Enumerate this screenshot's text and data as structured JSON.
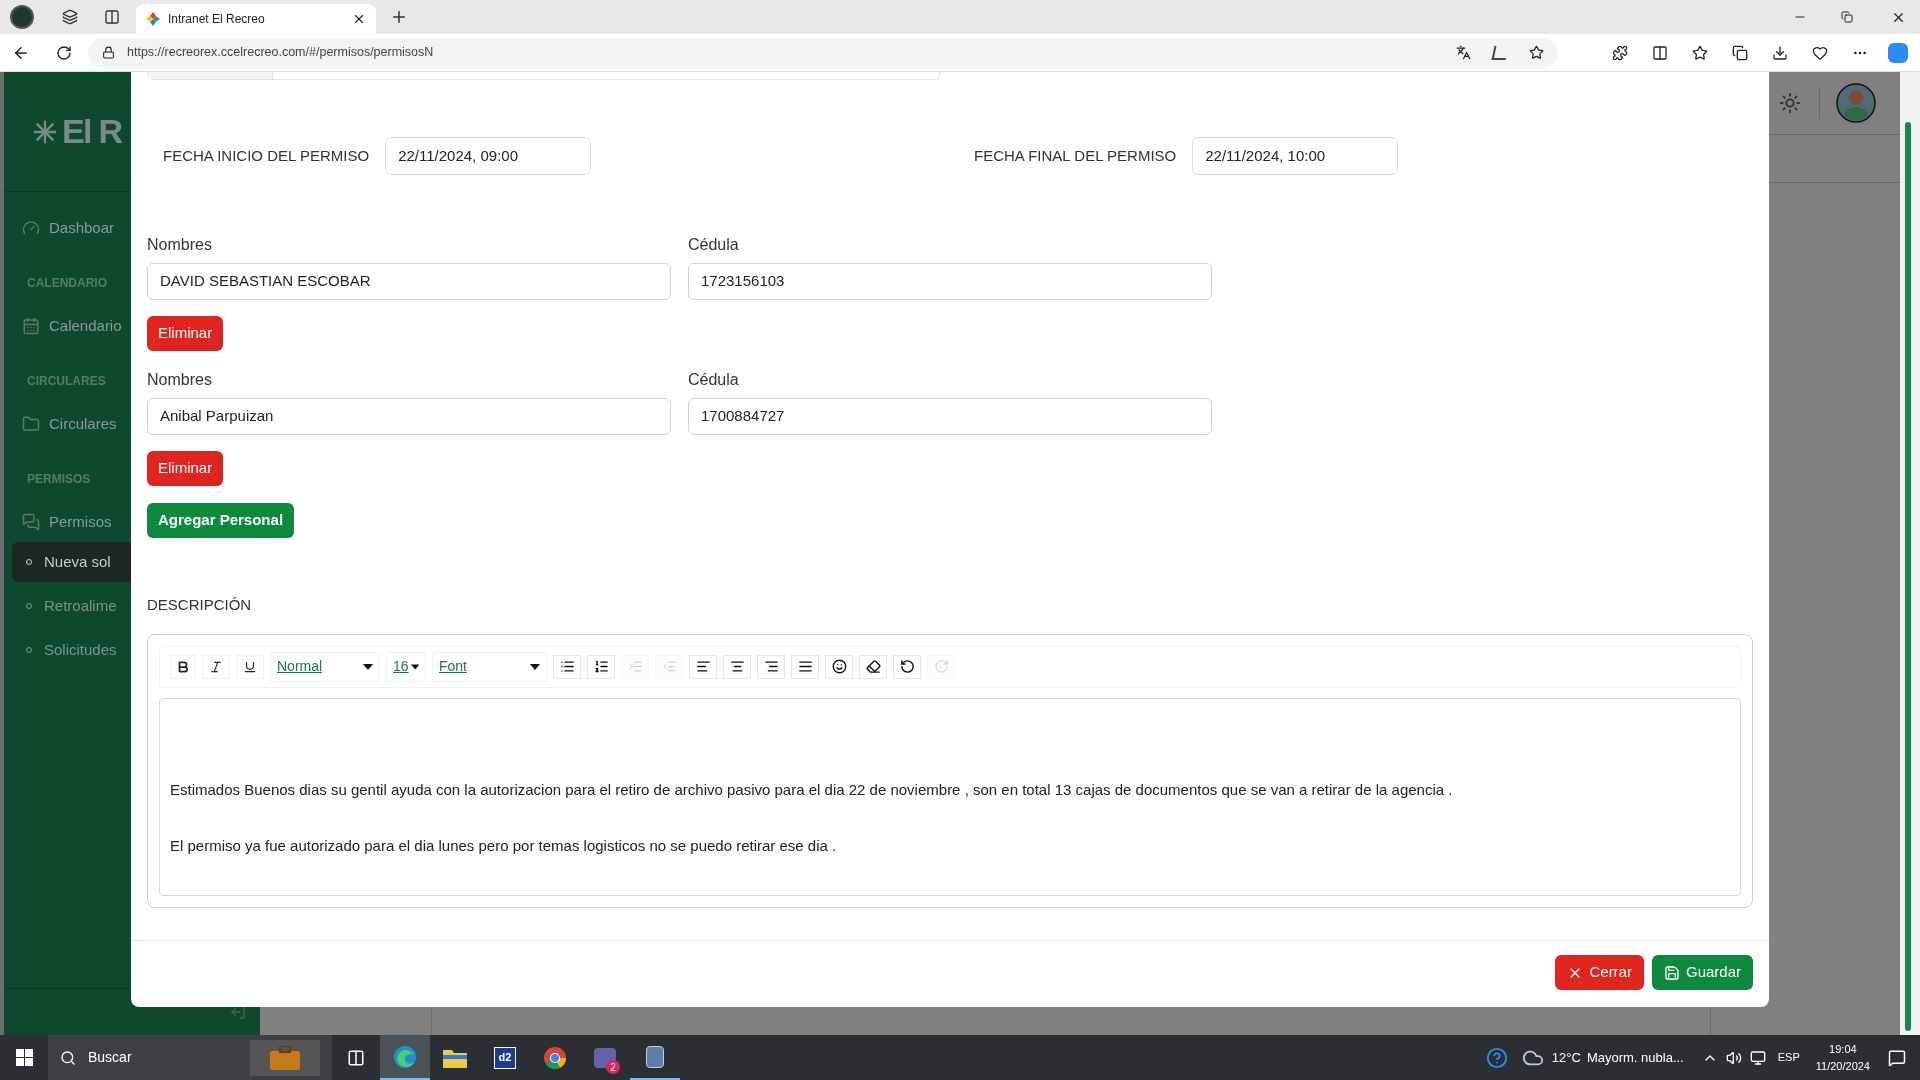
{
  "browser": {
    "tab_title": "Intranet El Recreo",
    "url": "https://recreorex.ccelrecreo.com/#/permisos/permisosN"
  },
  "sidebar": {
    "logo": "El R",
    "items": [
      {
        "kind": "item",
        "label": "Dashboar",
        "selected": false
      },
      {
        "kind": "header",
        "label": "CALENDARIO"
      },
      {
        "kind": "item",
        "label": "Calendario",
        "selected": false
      },
      {
        "kind": "header",
        "label": "CIRCULARES"
      },
      {
        "kind": "item",
        "label": "Circulares",
        "selected": false
      },
      {
        "kind": "header",
        "label": "PERMISOS"
      },
      {
        "kind": "item",
        "label": "Permisos",
        "selected": false
      },
      {
        "kind": "subitem",
        "label": "Nueva sol",
        "selected": true
      },
      {
        "kind": "subitem",
        "label": "Retroalime",
        "selected": false
      },
      {
        "kind": "subitem",
        "label": "Solicitudes",
        "selected": false
      }
    ]
  },
  "modal": {
    "start_label": "FECHA INICIO DEL PERMISO",
    "start_value": "22/11/2024, 09:00",
    "end_label": "FECHA FINAL DEL PERMISO",
    "end_value": "22/11/2024, 10:00",
    "people": [
      {
        "name_label": "Nombres",
        "name": "DAVID SEBASTIAN ESCOBAR",
        "id_label": "Cédula",
        "id": "1723156103",
        "remove": "Eliminar"
      },
      {
        "name_label": "Nombres",
        "name": "Anibal Parpuizan",
        "id_label": "Cédula",
        "id": "1700884727",
        "remove": "Eliminar"
      }
    ],
    "add_button": "Agregar Personal",
    "description_label": "DESCRIPCIÓN",
    "editor": {
      "block_type": "Normal",
      "font_size": "16",
      "font_family": "Font",
      "tools": [
        {
          "kind": "unordered",
          "disabled": false
        },
        {
          "kind": "ordered",
          "disabled": false
        },
        {
          "kind": "indent",
          "disabled": true
        },
        {
          "kind": "outdent",
          "disabled": true
        },
        {
          "kind": "left",
          "disabled": false
        },
        {
          "kind": "center",
          "disabled": false
        },
        {
          "kind": "right",
          "disabled": false
        },
        {
          "kind": "justify",
          "disabled": false
        },
        {
          "kind": "emoji",
          "disabled": false
        },
        {
          "kind": "eraser",
          "disabled": false
        },
        {
          "kind": "undo",
          "disabled": false
        },
        {
          "kind": "redo",
          "disabled": true
        }
      ],
      "paragraphs": [
        "Estimados Buenos dias su gentil ayuda con la autorizacion para el retiro de archivo pasivo para el dia 22 de noviembre , son en total 13 cajas de documentos que se van a retirar de la agencia .",
        "El permiso ya fue autorizado para el dia lunes pero por temas logisticos no se puedo retirar ese dia ."
      ]
    },
    "close_button": "Cerrar",
    "save_button": "Guardar"
  },
  "taskbar": {
    "search_placeholder": "Buscar",
    "app_label": "d2",
    "chat_badge": "2",
    "temperature": "12°C",
    "weather": "Mayorm. nubla...",
    "language": "ESP",
    "time": "19:04",
    "date": "11/20/2024"
  }
}
